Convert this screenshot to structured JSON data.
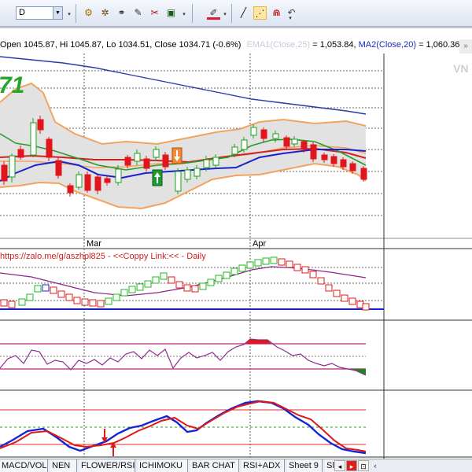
{
  "toolbar": {
    "period_value": "D",
    "tools": [
      {
        "name": "settings-cog-icon",
        "glyph": "⚙"
      },
      {
        "name": "cross-gear-icon",
        "glyph": "✲"
      },
      {
        "name": "glasses-icon",
        "glyph": "⚭"
      },
      {
        "name": "formula-edit-icon",
        "glyph": "✎"
      },
      {
        "name": "scissors-icon",
        "glyph": "✂"
      },
      {
        "name": "chart-export-icon",
        "glyph": "▣"
      },
      {
        "name": "pen-color-icon",
        "glyph": "✐"
      },
      {
        "name": "line-draw-icon",
        "glyph": "╱"
      },
      {
        "name": "dotted-line-icon",
        "glyph": "⋰"
      },
      {
        "name": "magnet-icon",
        "glyph": "⋒"
      },
      {
        "name": "undo-arrow-icon",
        "glyph": "↶"
      }
    ],
    "dropdown_glyph": "▾",
    "combo_arrow": "▼"
  },
  "info_bar": {
    "ohlc": "Open 1045.87, Hi 1045.87, Lo 1034.51, Close 1034.71 (-0.6%)",
    "ma1_label": "EMA1(Close,25)",
    "ma1_value": "= 1,053.84,",
    "ma2_label": "MA2(Close,20)",
    "ma2_value": "= 1,060.36,",
    "scroll_glyph": "»"
  },
  "main_chart": {
    "price_fragment": "71",
    "month_labels": [
      "Mar",
      "Apr"
    ],
    "watermark": "VN"
  },
  "indicator1": {
    "caption": "https://zalo.me/g/aszhpl825 - <<Coppy Link:<< - Daily"
  },
  "tabs": {
    "items": [
      "MACD/VOL",
      "NEN",
      "FLOWER/RSI",
      "ICHIMOKU",
      "BAR CHAT",
      "RSI+ADX",
      "Sheet 9",
      "Sl"
    ],
    "nav_glyphs": [
      "◂",
      "▸",
      "⊡",
      "▲"
    ],
    "more_glyph": "‹"
  },
  "chart_data": {
    "type": "candlestick",
    "x_labels": [
      "Mar",
      "Apr"
    ],
    "last_bar": {
      "open": 1045.87,
      "high": 1045.87,
      "low": 1034.51,
      "close": 1034.71,
      "change_pct": -0.6
    },
    "ma1": {
      "name": "EMA1(Close,25)",
      "value": 1053.84
    },
    "ma2": {
      "name": "MA2(Close,20)",
      "value": 1060.36
    },
    "colors": {
      "up": "#1aa11a",
      "down": "#e1161d",
      "bands": "#f4a35e",
      "ma_red": "#d22222",
      "ma_green": "#2a9b2a",
      "ma_blue": "#1a22cc",
      "long_ma": "#2a3aa8"
    }
  }
}
